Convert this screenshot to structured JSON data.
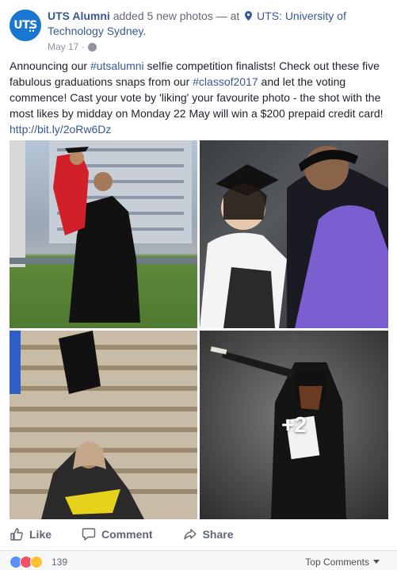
{
  "page": {
    "author": "UTS Alumni",
    "action": "added 5 new photos — at",
    "location": "UTS: University of Technology Sydney.",
    "date": "May 17 ·",
    "avatar_text": "UTS"
  },
  "post": {
    "text_segments": [
      "Announcing our ",
      "#utsalumni",
      " selfie competition finalists! Check out these five fabulous graduations snaps from our ",
      "#classof2017",
      " and let the voting commence! Cast your vote by 'liking' your favourite photo - the shot with the most likes by midday on Monday 22 May will win a $200 prepaid credit card! ",
      "http://bit.ly/2oRw6Dz"
    ]
  },
  "photos": {
    "more_count": "+2"
  },
  "actions": {
    "like": "Like",
    "comment": "Comment",
    "share": "Share"
  },
  "footer": {
    "reaction_count": "139",
    "top_comments": "Top Comments"
  },
  "colors": {
    "link": "#365899",
    "text": "#1d2129",
    "muted": "#90949c"
  }
}
